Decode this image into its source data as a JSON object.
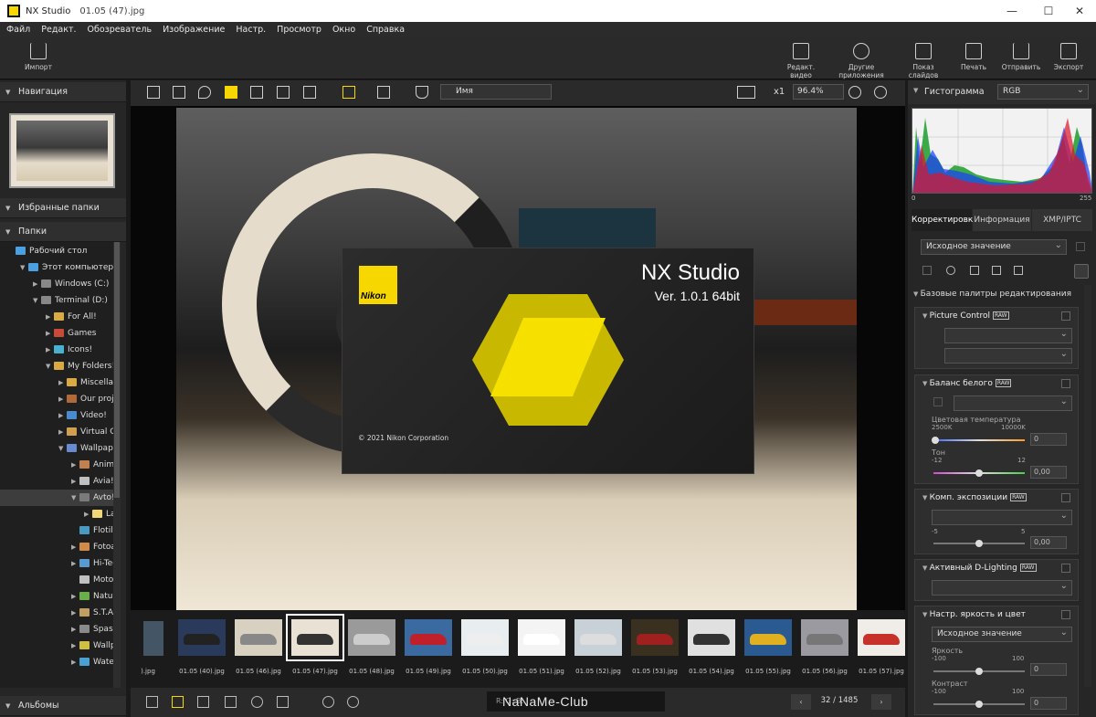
{
  "window": {
    "app_name": "NX Studio",
    "file_name": "01.05 (47).jpg",
    "minimize": "—",
    "maximize": "☐",
    "close": "✕"
  },
  "menu": [
    "Файл",
    "Редакт.",
    "Обозреватель",
    "Изображение",
    "Настр.",
    "Просмотр",
    "Окно",
    "Справка"
  ],
  "toolbar": {
    "import": "Импорт",
    "edit_video": "Редакт. видео",
    "other_apps": "Другие приложения",
    "slideshow": "Показ слайдов",
    "print": "Печать",
    "send": "Отправить",
    "export": "Экспорт"
  },
  "left": {
    "navigation": "Навигация",
    "favorites": "Избранные папки",
    "folders": "Папки",
    "albums": "Альбомы",
    "tree": [
      {
        "label": "Рабочий стол",
        "depth": 0,
        "arrow": ""
      },
      {
        "label": "Этот компьютер",
        "depth": 1,
        "arrow": "▼"
      },
      {
        "label": "Windows (C:)",
        "depth": 2,
        "arrow": "▶"
      },
      {
        "label": "Terminal (D:)",
        "depth": 2,
        "arrow": "▼"
      },
      {
        "label": "For All!",
        "depth": 3,
        "arrow": "▶"
      },
      {
        "label": "Games",
        "depth": 3,
        "arrow": "▶"
      },
      {
        "label": "Icons!",
        "depth": 3,
        "arrow": "▶"
      },
      {
        "label": "My Folders!",
        "depth": 3,
        "arrow": "▼"
      },
      {
        "label": "Miscellane",
        "depth": 4,
        "arrow": "▶"
      },
      {
        "label": "Our projec",
        "depth": 4,
        "arrow": "▶"
      },
      {
        "label": "Video!",
        "depth": 4,
        "arrow": "▶"
      },
      {
        "label": "Virtual CD!",
        "depth": 4,
        "arrow": "▶"
      },
      {
        "label": "Wallpaper",
        "depth": 4,
        "arrow": "▼"
      },
      {
        "label": "Animal",
        "depth": 5,
        "arrow": "▶"
      },
      {
        "label": "Avia!",
        "depth": 5,
        "arrow": "▶"
      },
      {
        "label": "Avto!",
        "depth": 5,
        "arrow": "▼"
      },
      {
        "label": "Lac",
        "depth": 6,
        "arrow": "▶"
      },
      {
        "label": "Flotilla",
        "depth": 5,
        "arrow": ""
      },
      {
        "label": "Fotoall",
        "depth": 5,
        "arrow": "▶"
      },
      {
        "label": "Hi-Tech",
        "depth": 5,
        "arrow": "▶"
      },
      {
        "label": "Moto!",
        "depth": 5,
        "arrow": ""
      },
      {
        "label": "Nature",
        "depth": 5,
        "arrow": "▶"
      },
      {
        "label": "S.T.A.L.",
        "depth": 5,
        "arrow": "▶"
      },
      {
        "label": "Spase!",
        "depth": 5,
        "arrow": "▶"
      },
      {
        "label": "Wallpa",
        "depth": 5,
        "arrow": "▶"
      },
      {
        "label": "Water!",
        "depth": 5,
        "arrow": "▶"
      }
    ]
  },
  "center": {
    "sort_label": "Имя",
    "zoom_x1": "x1",
    "zoom_value": "96.4%",
    "splash": {
      "brand": "Nikon",
      "title": "NX Studio",
      "version": "Ver. 1.0.1  64bit",
      "copyright": "© 2021 Nikon Corporation"
    },
    "filmstrip": [
      "01.05 (40).jpg",
      "01.05 (46).jpg",
      "01.05 (47).jpg",
      "01.05 (48).jpg",
      "01.05 (49).jpg",
      "01.05 (50).jpg",
      "01.05 (51).jpg",
      "01.05 (52).jpg",
      "01.05 (53).jpg",
      "01.05 (54).jpg",
      "01.05 (55).jpg",
      "01.05 (56).jpg",
      "01.05 (57).jpg"
    ],
    "partial_thumb_label": ").jpg",
    "selected_index": 2,
    "rgb_info": "R:        G:        B:",
    "watermark": "NaNaMe-Club",
    "page_count": "32 / 1485"
  },
  "right": {
    "histogram_label": "Гистограмма",
    "histogram_channel": "RGB",
    "hist_min": "0",
    "hist_max": "255",
    "tabs": [
      "Корректировки",
      "Информация",
      "XMP/IPTC"
    ],
    "preset": "Исходное значение",
    "basic_palettes": "Базовые палитры редактирования",
    "picture_control": "Picture Control",
    "white_balance": "Баланс белого",
    "color_temp": "Цветовая температура",
    "temp_min": "2500K",
    "temp_max": "10000K",
    "temp_value": "0",
    "tone": "Тон",
    "tone_min": "-12",
    "tone_max": "12",
    "tone_value": "0,00",
    "exposure": "Комп. экспозиции",
    "exp_min": "-5",
    "exp_max": "5",
    "exp_value": "0,00",
    "adl": "Активный D-Lighting",
    "brightness_color": "Настр. яркость и цвет",
    "bc_preset": "Исходное значение",
    "brightness": "Яркость",
    "br_min": "-100",
    "br_max": "100",
    "br_value": "0",
    "contrast": "Контраст",
    "ct_min": "-100",
    "ct_max": "100",
    "ct_value": "0",
    "raw_badge": "RAW"
  }
}
